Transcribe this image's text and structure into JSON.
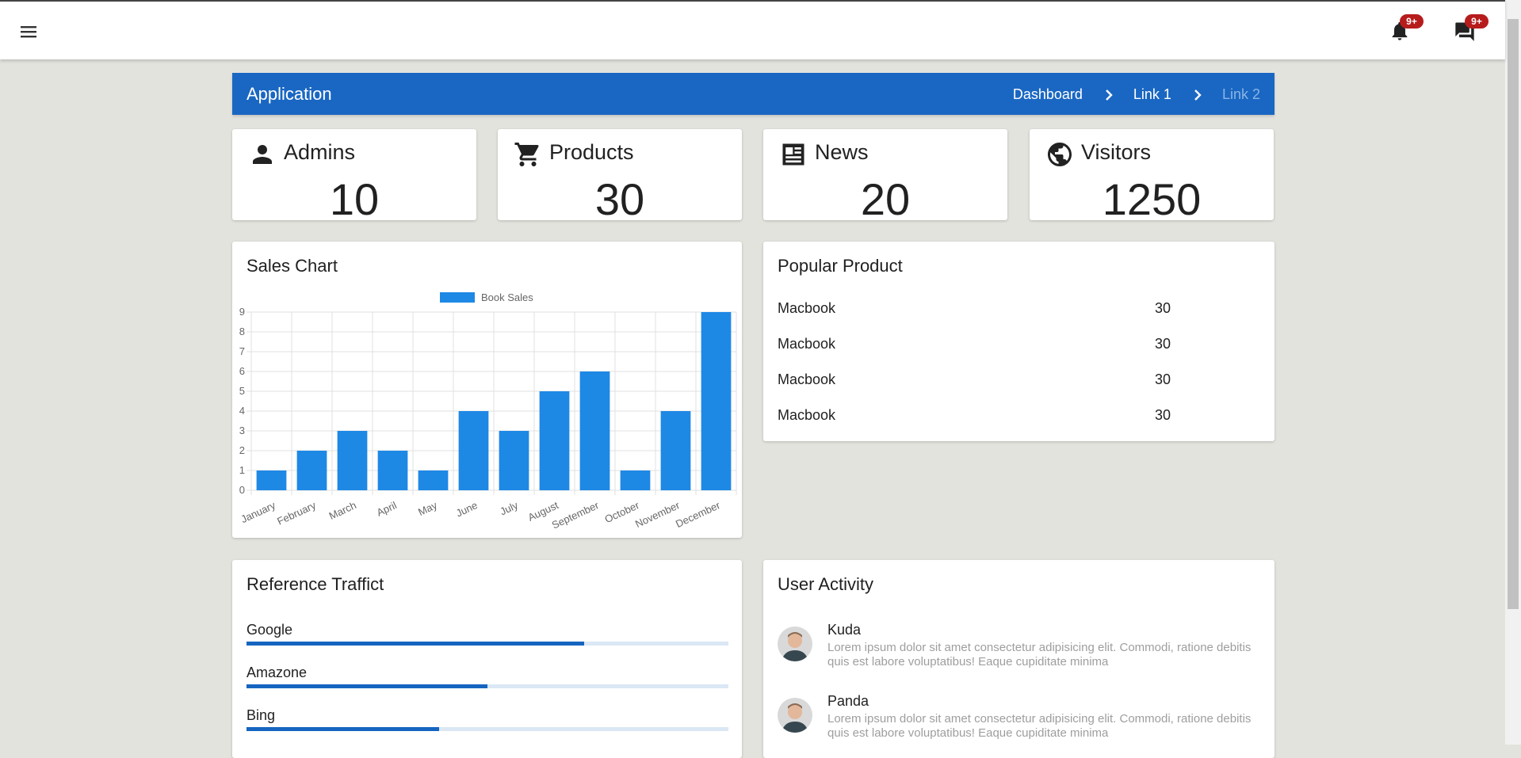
{
  "topbar": {
    "menu_icon": "menu-icon",
    "notifications": {
      "icon": "bell-icon",
      "badge": "9+"
    },
    "messages": {
      "icon": "message-icon",
      "badge": "9+"
    }
  },
  "appbar": {
    "title": "Application",
    "breadcrumbs": [
      {
        "label": "Dashboard",
        "active": true
      },
      {
        "label": "Link 1",
        "active": true
      },
      {
        "label": "Link 2",
        "active": false
      }
    ]
  },
  "stats": [
    {
      "label": "Admins",
      "value": "10",
      "icon": "person-icon"
    },
    {
      "label": "Products",
      "value": "30",
      "icon": "cart-icon"
    },
    {
      "label": "News",
      "value": "20",
      "icon": "newspaper-icon"
    },
    {
      "label": "Visitors",
      "value": "1250",
      "icon": "globe-icon"
    }
  ],
  "sales_chart": {
    "title": "Sales Chart"
  },
  "chart_data": {
    "type": "bar",
    "categories": [
      "January",
      "February",
      "March",
      "April",
      "May",
      "June",
      "July",
      "August",
      "September",
      "October",
      "November",
      "December"
    ],
    "series": [
      {
        "name": "Book Sales",
        "values": [
          1,
          2,
          3,
          2,
          1,
          4,
          3,
          5,
          6,
          1,
          4,
          9
        ]
      }
    ],
    "title": "",
    "xlabel": "",
    "ylabel": "",
    "ylim": [
      0,
      9
    ],
    "yticks": [
      0,
      1,
      2,
      3,
      4,
      5,
      6,
      7,
      8,
      9
    ],
    "grid": true,
    "legend": "top",
    "color": "#1e88e5"
  },
  "popular_product": {
    "title": "Popular Product",
    "rows": [
      {
        "name": "Macbook",
        "count": "30"
      },
      {
        "name": "Macbook",
        "count": "30"
      },
      {
        "name": "Macbook",
        "count": "30"
      },
      {
        "name": "Macbook",
        "count": "30"
      }
    ]
  },
  "traffic": {
    "title": "Reference Traffict",
    "items": [
      {
        "label": "Google",
        "percent": 70
      },
      {
        "label": "Amazone",
        "percent": 50
      },
      {
        "label": "Bing",
        "percent": 40
      }
    ]
  },
  "activity": {
    "title": "User Activity",
    "items": [
      {
        "name": "Kuda",
        "text": "Lorem ipsum dolor sit amet consectetur adipisicing elit. Commodi, ratione debitis quis est labore voluptatibus! Eaque cupiditate minima"
      },
      {
        "name": "Panda",
        "text": "Lorem ipsum dolor sit amet consectetur adipisicing elit. Commodi, ratione debitis quis est labore voluptatibus! Eaque cupiditate minima"
      }
    ]
  },
  "colors": {
    "primary": "#1a67c3",
    "bar": "#1e88e5",
    "badge": "#b71c1c",
    "background": "#e3e3de"
  }
}
